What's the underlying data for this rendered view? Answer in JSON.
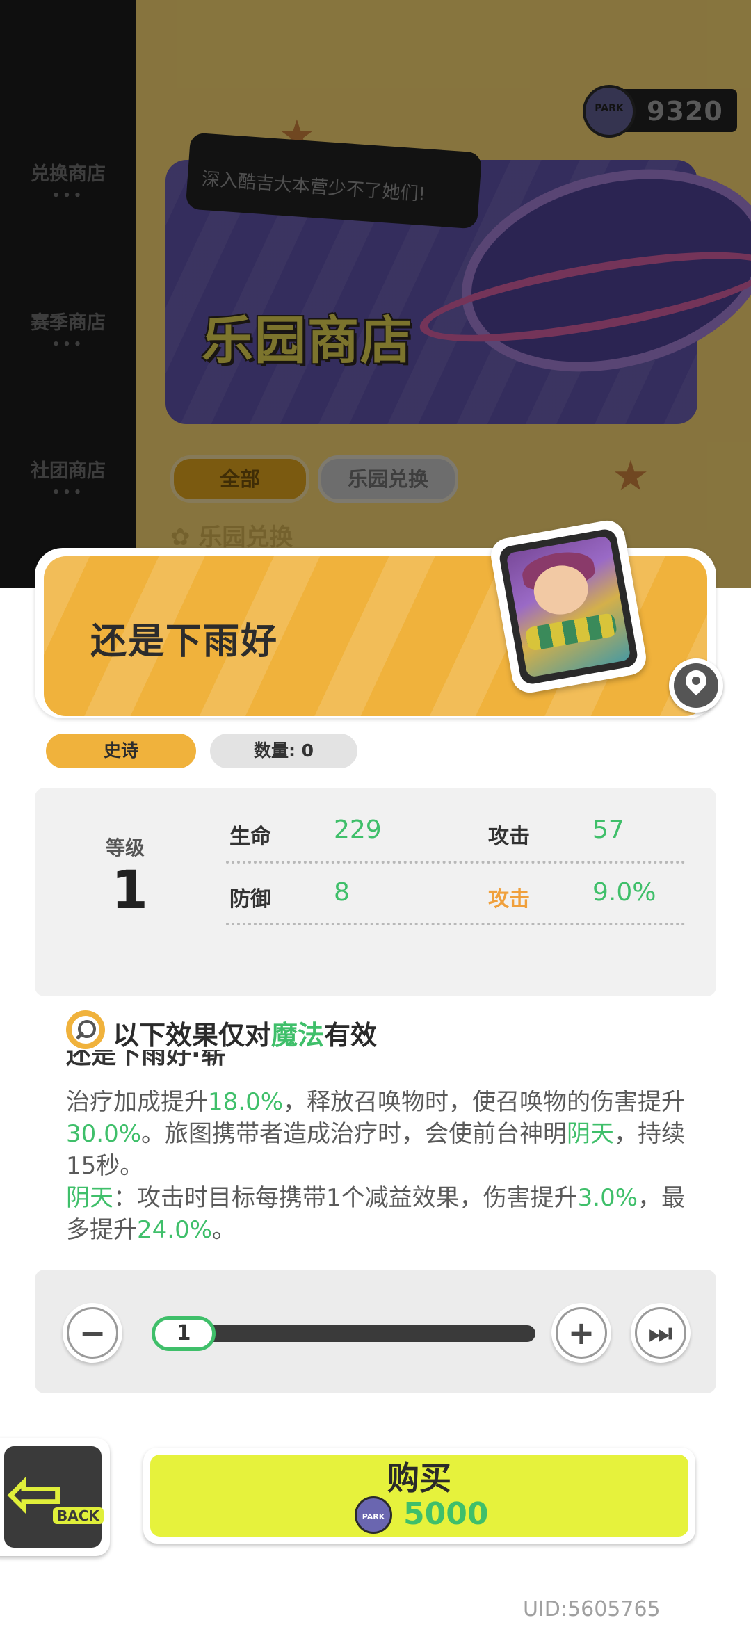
{
  "background": {
    "sidebar_items": [
      {
        "label": "兑换商店",
        "dots": "•••"
      },
      {
        "label": "赛季商店",
        "dots": "•••"
      },
      {
        "label": "社团商店",
        "dots": "•••"
      }
    ],
    "currency": {
      "icon": "park-coin-icon",
      "logo_text": "PARK",
      "value": "9320"
    },
    "speech_bubble": "深入酷吉大本营少不了她们!",
    "banner_title": "乐园商店",
    "tabs": [
      "全部",
      "乐园兑换"
    ],
    "section_label": "✿ 乐园兑换"
  },
  "item": {
    "name": "还是下雨好",
    "rarity": "史诗",
    "quantity_label": "数量: 0"
  },
  "stats": {
    "level_label": "等级",
    "level_value": "1",
    "rows": [
      [
        {
          "name": "生命",
          "value": "229"
        },
        {
          "name": "攻击",
          "value": "57"
        }
      ],
      [
        {
          "name": "防御",
          "value": "8"
        },
        {
          "name": "攻击",
          "value": "9.0%"
        }
      ]
    ]
  },
  "effect": {
    "prefix": "以下效果仅对",
    "keyword": "魔法",
    "suffix": "有效",
    "cut_title": "还是下雨好·崭",
    "desc": {
      "p1": "治疗加成提升",
      "v1": "18.0%",
      "p2": "，释放召唤物时，使召唤物的伤害提升",
      "v2": "30.0%",
      "p3": "。旅图携带者造成治疗时，会使前台神明",
      "v3": "阴天",
      "p4": "，持续15秒。",
      "v4": "阴天",
      "p5": "：攻击时目标每携带1个减益效果，伤害提升",
      "v5": "3.0%",
      "p6": "，最多提升",
      "v6": "24.0%",
      "p7": "。"
    }
  },
  "quantity": {
    "minus": "−",
    "plus": "+",
    "max": "⏭",
    "value": "1"
  },
  "buy": {
    "label": "购买",
    "coin_text": "PARK",
    "price": "5000"
  },
  "back": {
    "label": "BACK"
  },
  "uid": "UID:5605765",
  "colors": {
    "accent_orange": "#f0b23c",
    "value_green": "#3fbf6a",
    "buy_yellow": "#e6f23c"
  }
}
